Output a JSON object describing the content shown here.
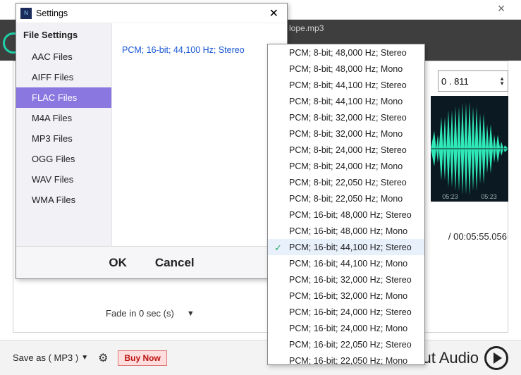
{
  "app": {
    "filename": "lope.mp3",
    "time_value": "0 . 811",
    "time_stepper_up": "▲",
    "time_stepper_down": "▼",
    "waveform_ticks": [
      "05:23",
      "05:23"
    ],
    "duration": "/ 00:05:55.056"
  },
  "fade": {
    "label": "Fade in 0 sec (s)",
    "arrow": "▼"
  },
  "bottom": {
    "saveas": "Save as ( MP3 )",
    "saveas_arrow": "▼",
    "gear": "⚙",
    "buy_now": "Buy Now",
    "cut_audio": "ut Audio"
  },
  "dialog": {
    "title": "Settings",
    "sidebar_header": "File Settings",
    "sidebar_items": [
      {
        "label": "AAC Files"
      },
      {
        "label": "AIFF Files"
      },
      {
        "label": "FLAC Files",
        "selected": true
      },
      {
        "label": "M4A Files"
      },
      {
        "label": "MP3 Files"
      },
      {
        "label": "OGG Files"
      },
      {
        "label": "WAV Files"
      },
      {
        "label": "WMA Files"
      }
    ],
    "current_value": "PCM; 16-bit; 44,100 Hz; Stereo",
    "ok": "OK",
    "cancel": "Cancel"
  },
  "dropdown": {
    "options": [
      "PCM; 8-bit; 48,000 Hz; Stereo",
      "PCM; 8-bit; 48,000 Hz; Mono",
      "PCM; 8-bit; 44,100 Hz; Stereo",
      "PCM; 8-bit; 44,100 Hz; Mono",
      "PCM; 8-bit; 32,000 Hz; Stereo",
      "PCM; 8-bit; 32,000 Hz; Mono",
      "PCM; 8-bit; 24,000 Hz; Stereo",
      "PCM; 8-bit; 24,000 Hz; Mono",
      "PCM; 8-bit; 22,050 Hz; Stereo",
      "PCM; 8-bit; 22,050 Hz; Mono",
      "PCM; 16-bit; 48,000 Hz; Stereo",
      "PCM; 16-bit; 48,000 Hz; Mono",
      "PCM; 16-bit; 44,100 Hz; Stereo",
      "PCM; 16-bit; 44,100 Hz; Mono",
      "PCM; 16-bit; 32,000 Hz; Stereo",
      "PCM; 16-bit; 32,000 Hz; Mono",
      "PCM; 16-bit; 24,000 Hz; Stereo",
      "PCM; 16-bit; 24,000 Hz; Mono",
      "PCM; 16-bit; 22,050 Hz; Stereo",
      "PCM; 16-bit; 22,050 Hz; Mono"
    ],
    "selected_index": 12
  }
}
